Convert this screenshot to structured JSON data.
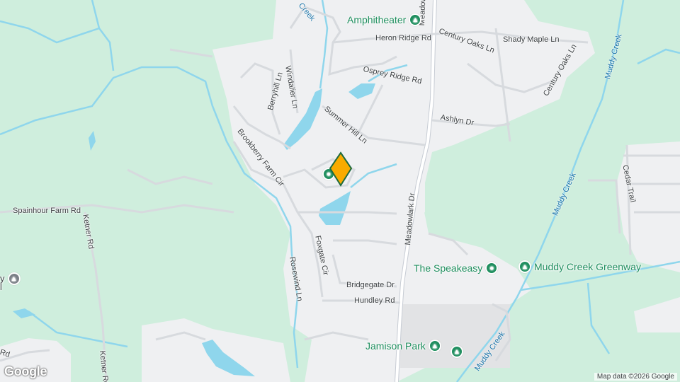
{
  "map": {
    "colors": {
      "land": "#cfeedd",
      "urban": "#eff0f2",
      "road": "#ffffff",
      "road_major": "#c7ccd4",
      "water": "#8fd6ec",
      "poi": "#1e8e5e",
      "marker": "#f9ab00"
    },
    "roads": {
      "heron_ridge": "Heron Ridge Rd",
      "century_oaks_1": "Century Oaks Ln",
      "century_oaks_2": "Century Oaks Ln",
      "shady_maple": "Shady Maple Ln",
      "osprey_ridge": "Osprey Ridge Rd",
      "berryhill": "Berryhill Ln",
      "windalier": "Windalier Ln",
      "summer_hill": "Summer Hill Ln",
      "ashlyn": "Ashlyn Dr",
      "brookberry": "Brookberry Farm Cir",
      "cedar_trail": "Cedar Trail",
      "spainhour": "Spainhour Farm Rd",
      "ketner_1": "Ketner Rd",
      "ketner_2": "Ketner Rd",
      "meadowlark_1": "Meadowlark Dr",
      "meadowlark_2": "Meadowlark Dr",
      "foxgate": "Foxgate Cir",
      "rosewind": "Rosewind Ln",
      "bridgegate": "Bridgegate Dr",
      "hundley": "Hundley Rd",
      "edge_rd": "Rd"
    },
    "water": {
      "muddy_creek_1": "Muddy Creek",
      "muddy_creek_2": "Muddy Creek",
      "muddy_creek_3": "Muddy Creek",
      "creek_top": "Creek"
    },
    "pois": {
      "amphitheater": "Amphitheater",
      "speakeasy": "The Speakeasy",
      "greenway": "Muddy Creek Greenway",
      "jamison": "Jamison Park",
      "school_partial_1": "y",
      "school_partial_2": "l"
    },
    "icons": {
      "park": "tree-icon",
      "venue": "place-icon",
      "school": "school-icon",
      "marker": "location-marker-icon"
    },
    "attribution": "Map data ©2026 Google",
    "logo": "Google"
  }
}
